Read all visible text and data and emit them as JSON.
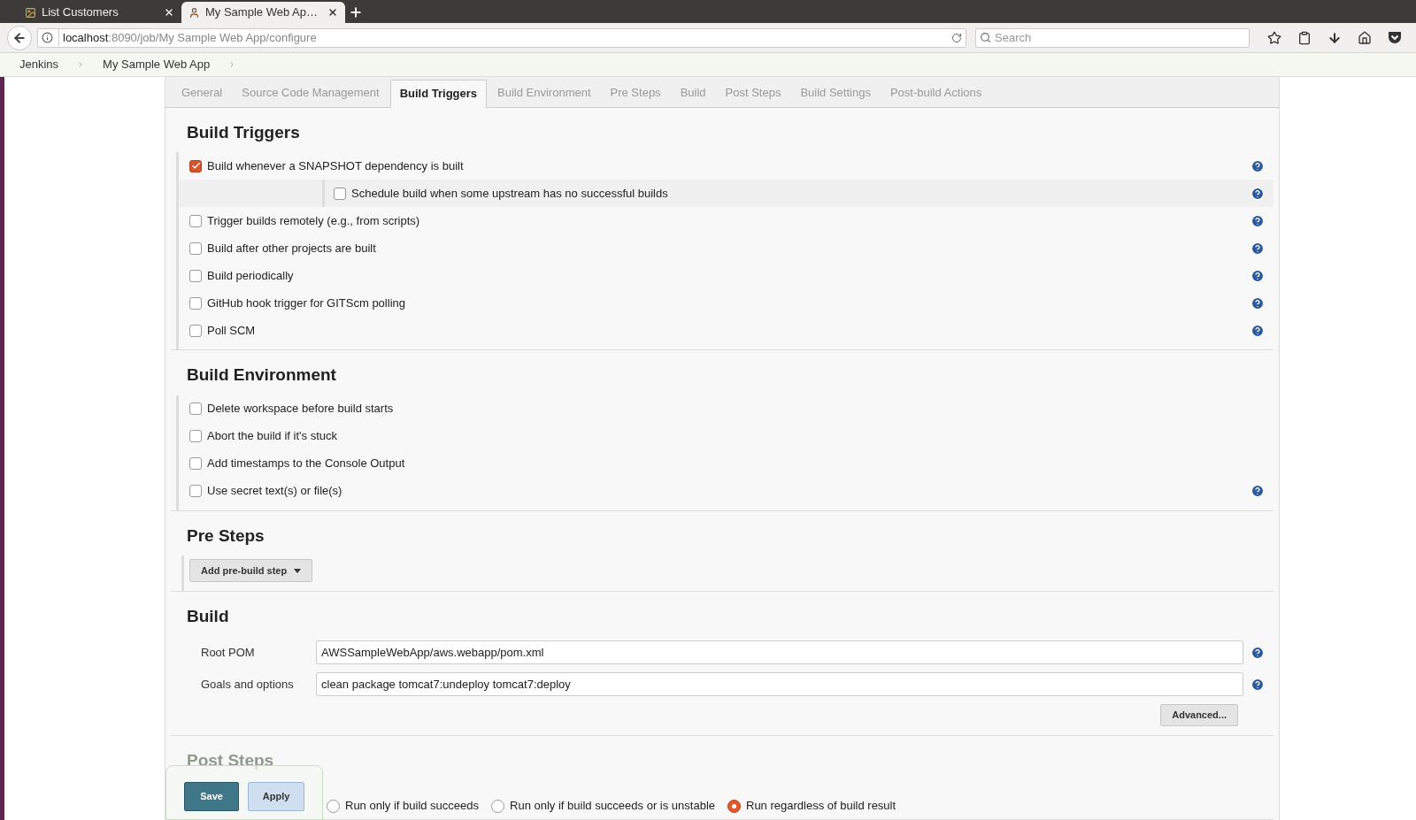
{
  "browser": {
    "tabs": [
      {
        "title": "List Customers",
        "selected": false
      },
      {
        "title": "My Sample Web Ap…",
        "selected": true
      }
    ],
    "url": {
      "host": "localhost",
      "path": ":8090/job/My Sample Web App/configure"
    },
    "search": {
      "placeholder": "Search"
    }
  },
  "breadcrumbs": [
    "Jenkins",
    "My Sample Web App"
  ],
  "config_tabs": [
    {
      "label": "General",
      "selected": false
    },
    {
      "label": "Source Code Management",
      "selected": false
    },
    {
      "label": "Build Triggers",
      "selected": true
    },
    {
      "label": "Build Environment",
      "selected": false
    },
    {
      "label": "Pre Steps",
      "selected": false
    },
    {
      "label": "Build",
      "selected": false
    },
    {
      "label": "Post Steps",
      "selected": false
    },
    {
      "label": "Build Settings",
      "selected": false
    },
    {
      "label": "Post-build Actions",
      "selected": false
    }
  ],
  "sections": [
    {
      "kind": "checkboxes",
      "title": "Build Triggers",
      "items": [
        {
          "label": "Build whenever a SNAPSHOT dependency is built",
          "checked": true,
          "help": true,
          "children": [
            {
              "label": "Schedule build when some upstream has no successful builds",
              "checked": false,
              "help": true
            }
          ]
        },
        {
          "label": "Trigger builds remotely (e.g., from scripts)",
          "checked": false,
          "help": true
        },
        {
          "label": "Build after other projects are built",
          "checked": false,
          "help": true
        },
        {
          "label": "Build periodically",
          "checked": false,
          "help": true
        },
        {
          "label": "GitHub hook trigger for GITScm polling",
          "checked": false,
          "help": true
        },
        {
          "label": "Poll SCM",
          "checked": false,
          "help": true
        }
      ]
    },
    {
      "kind": "checkboxes",
      "title": "Build Environment",
      "items": [
        {
          "label": "Delete workspace before build starts",
          "checked": false,
          "help": false
        },
        {
          "label": "Abort the build if it's stuck",
          "checked": false,
          "help": false
        },
        {
          "label": "Add timestamps to the Console Output",
          "checked": false,
          "help": false
        },
        {
          "label": "Use secret text(s) or file(s)",
          "checked": false,
          "help": true
        }
      ]
    },
    {
      "kind": "dropdown",
      "title": "Pre Steps",
      "button": "Add pre-build step"
    },
    {
      "kind": "fields",
      "title": "Build",
      "fields": [
        {
          "label": "Root POM",
          "value": "AWSSampleWebApp/aws.webapp/pom.xml"
        },
        {
          "label": "Goals and options",
          "value": "clean package tomcat7:undeploy tomcat7:deploy"
        }
      ],
      "button": "Advanced..."
    },
    {
      "kind": "radios",
      "title": "Post Steps",
      "options": [
        {
          "label": "Run only if build succeeds",
          "selected": false
        },
        {
          "label": "Run only if build succeeds or is unstable",
          "selected": false
        },
        {
          "label": "Run regardless of build result",
          "selected": true
        }
      ]
    }
  ],
  "actions": {
    "save": "Save",
    "apply": "Apply"
  }
}
